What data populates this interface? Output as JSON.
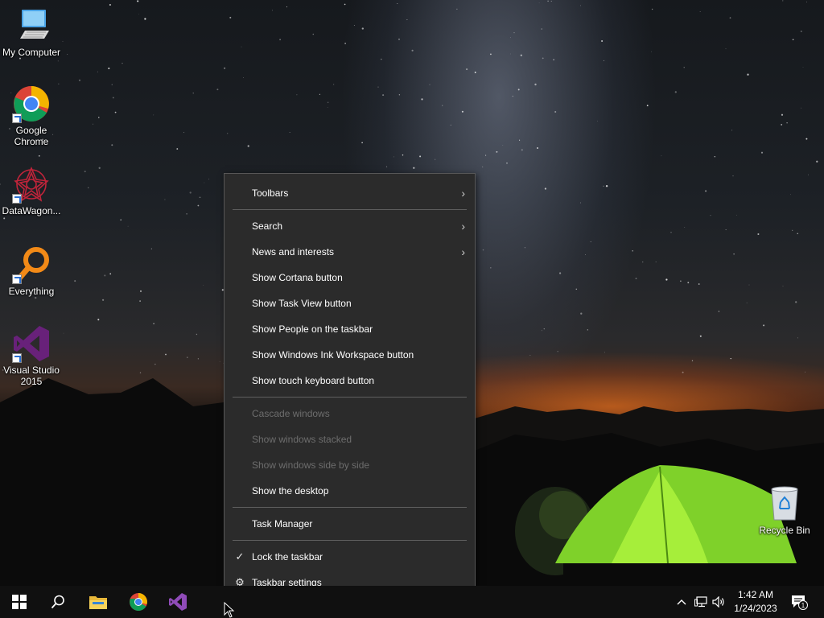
{
  "desktop_icons": [
    {
      "label": "My Computer",
      "icon": "computer-icon"
    },
    {
      "label": "Google Chrome",
      "icon": "chrome-icon"
    },
    {
      "label": "DataWagon...",
      "icon": "datawagon-icon"
    },
    {
      "label": "Everything",
      "icon": "everything-search-icon"
    },
    {
      "label": "Visual Studio 2015",
      "icon": "visual-studio-icon"
    },
    {
      "label": "Recycle Bin",
      "icon": "recycle-bin-icon"
    }
  ],
  "context_menu": {
    "toolbars": "Toolbars",
    "search": "Search",
    "news": "News and interests",
    "cortana": "Show Cortana button",
    "task_view": "Show Task View button",
    "people": "Show People on the taskbar",
    "ink": "Show Windows Ink Workspace button",
    "touch_keyboard": "Show touch keyboard button",
    "cascade": "Cascade windows",
    "stacked": "Show windows stacked",
    "side_by_side": "Show windows side by side",
    "show_desktop": "Show the desktop",
    "task_manager": "Task Manager",
    "lock_taskbar": "Lock the taskbar",
    "lock_taskbar_checked": true,
    "taskbar_settings": "Taskbar settings",
    "submenu_glyph": "›",
    "check_glyph": "✓",
    "gear_glyph": "⚙"
  },
  "taskbar": {
    "pinned": [
      "start-icon",
      "search-icon",
      "file-explorer-icon",
      "chrome-icon",
      "visual-studio-icon"
    ],
    "tray_icons": [
      "chevron-up-icon",
      "network-icon",
      "volume-icon"
    ],
    "time": "1:42 AM",
    "date": "1/24/2023",
    "notification_count": "1"
  },
  "colors": {
    "menu_bg": "#2b2b2b",
    "menu_disabled": "#6d6d6d",
    "taskbar_bg": "#101010",
    "tent_green": "#8ae62a",
    "vs_purple": "#68217a"
  }
}
